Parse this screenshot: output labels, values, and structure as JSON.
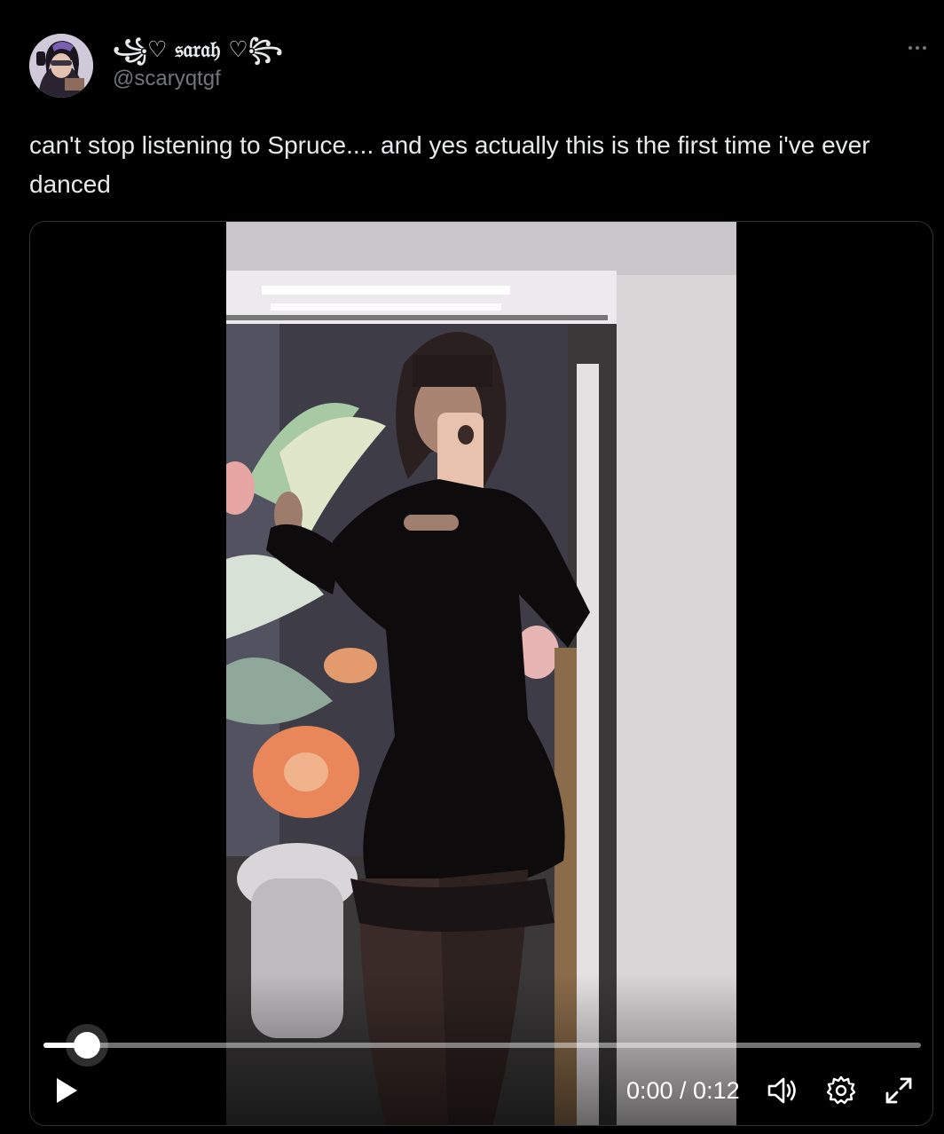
{
  "post": {
    "display_name": "꧁♡ 𝔰𝔞𝔯𝔞𝔥 ♡꧂",
    "handle": "@scaryqtgf",
    "text": "can't stop listening to Spruce.... and yes actually this is the first time i've ever danced",
    "more_icon": "more-horizontal-icon"
  },
  "video": {
    "current_time": "0:00",
    "duration": "0:12",
    "time_display": "0:00 / 0:12",
    "progress_fraction": 0.05,
    "play_icon": "play-icon",
    "volume_icon": "volume-icon",
    "settings_icon": "gear-icon",
    "fullscreen_icon": "fullscreen-icon"
  },
  "colors": {
    "background": "#000000",
    "text_primary": "#e7e9ea",
    "text_secondary": "#71767b",
    "border": "#2f3336"
  }
}
